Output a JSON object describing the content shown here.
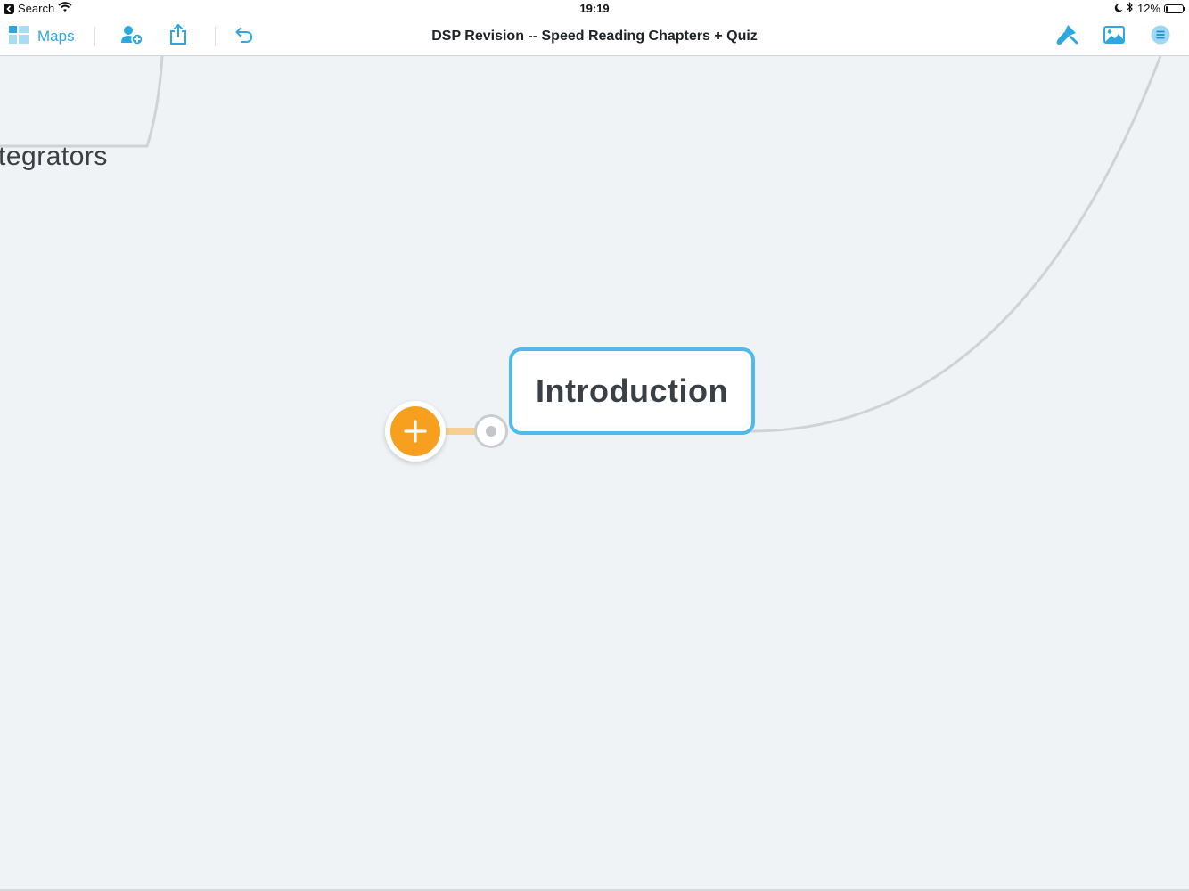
{
  "status_bar": {
    "back_label": "Search",
    "time": "19:19",
    "battery_text": "12%",
    "battery_level": 0.12
  },
  "toolbar": {
    "maps_label": "Maps",
    "document_title": "DSP Revision -- Speed Reading Chapters + Quiz"
  },
  "canvas": {
    "partial_node_text": "tegrators",
    "selected_node_text": "Introduction"
  },
  "colors": {
    "accent": "#2ea7e0",
    "selection_border": "#4fb9ee",
    "add_button": "#f7a020",
    "connector": "#f5cf94",
    "branch_line": "#cfd3d6",
    "canvas_bg": "#eff3f6"
  },
  "icons": {
    "maps": "grid-icon",
    "add_person": "add-person-icon",
    "share": "share-icon",
    "undo": "undo-icon",
    "style": "paint-brush-icon",
    "image": "image-icon",
    "outline": "outline-list-icon"
  }
}
